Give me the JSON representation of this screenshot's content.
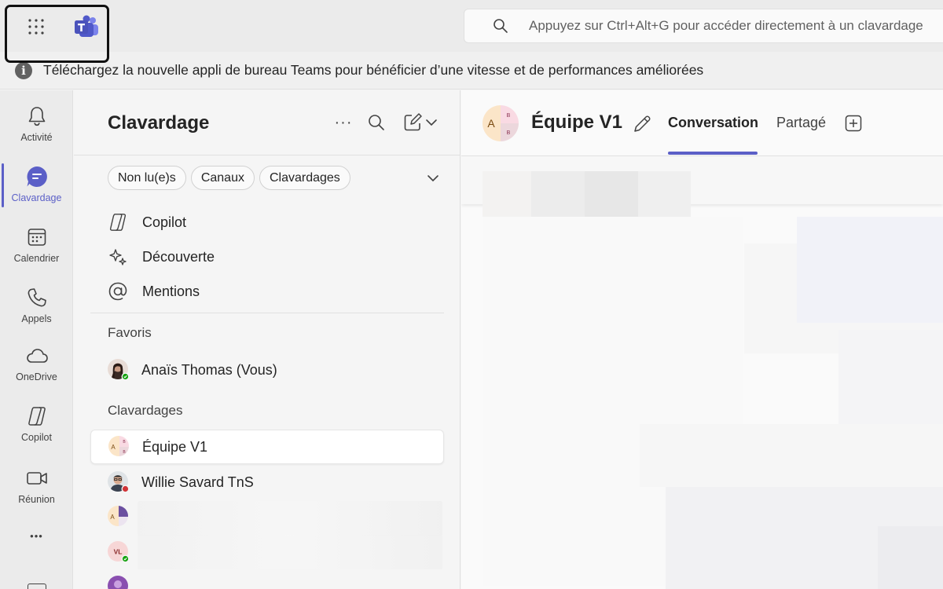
{
  "titlebar": {
    "launcher_icon": "app-launcher-grid-icon",
    "app_logo": "teams-logo-icon",
    "search_placeholder": "Appuyez sur Ctrl+Alt+G pour accéder directement à un clavardage"
  },
  "banner": {
    "icon": "info-icon",
    "text": "Téléchargez la nouvelle appli de bureau Teams pour bénéficier d’une vitesse et de performances améliorées"
  },
  "rail": {
    "items": [
      {
        "label": "Activité",
        "icon": "bell-icon"
      },
      {
        "label": "Clavardage",
        "icon": "chat-icon",
        "active": true
      },
      {
        "label": "Calendrier",
        "icon": "calendar-icon"
      },
      {
        "label": "Appels",
        "icon": "phone-icon"
      },
      {
        "label": "OneDrive",
        "icon": "cloud-icon"
      },
      {
        "label": "Copilot",
        "icon": "copilot-icon"
      },
      {
        "label": "Réunion",
        "icon": "video-icon"
      }
    ],
    "more_label": "•••"
  },
  "chatlist": {
    "title": "Clavardage",
    "more_label": "···",
    "filters": [
      "Non lu(e)s",
      "Canaux",
      "Clavardages"
    ],
    "nav": [
      {
        "label": "Copilot",
        "icon": "copilot-icon"
      },
      {
        "label": "Découverte",
        "icon": "sparkle-icon"
      },
      {
        "label": "Mentions",
        "icon": "at-icon"
      }
    ],
    "favorites_label": "Favoris",
    "favorites": [
      {
        "name": "Anaïs Thomas (Vous)",
        "status": "available"
      }
    ],
    "chats_label": "Clavardages",
    "chats": [
      {
        "name": "Équipe V1",
        "selected": true
      },
      {
        "name": "Willie Savard TnS",
        "status": "busy"
      },
      {
        "name": ""
      },
      {
        "name": "",
        "initials": "VL",
        "status": "available"
      },
      {
        "name": ""
      }
    ],
    "group_avatar_letters": {
      "a": "A",
      "b": "B"
    }
  },
  "main": {
    "title": "Équipe V1",
    "tabs": [
      {
        "label": "Conversation",
        "active": true
      },
      {
        "label": "Partagé"
      }
    ],
    "avatar_letters": {
      "a": "A",
      "b": "B"
    }
  },
  "colors": {
    "accent": "#5b5fc7",
    "available": "#13a10e",
    "busy": "#d13438"
  }
}
